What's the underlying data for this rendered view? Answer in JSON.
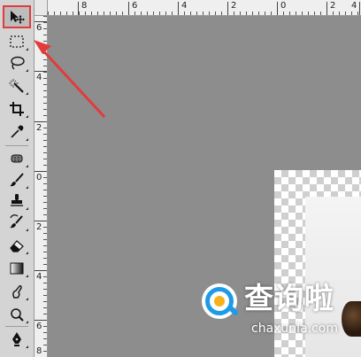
{
  "rulers": {
    "top_labels": [
      "8",
      "6",
      "4",
      "2",
      "0",
      "2",
      "4"
    ],
    "left_labels": [
      "6",
      "4",
      "2",
      "0",
      "2",
      "4",
      "6",
      "8"
    ]
  },
  "tools": [
    {
      "name": "move-tool",
      "selected": true
    },
    {
      "name": "rectangular-marquee-tool"
    },
    {
      "name": "lasso-tool"
    },
    {
      "name": "magic-wand-tool"
    },
    {
      "name": "crop-tool"
    },
    {
      "name": "eyedropper-tool"
    },
    {
      "name": "spot-healing-brush-tool"
    },
    {
      "name": "brush-tool"
    },
    {
      "name": "clone-stamp-tool"
    },
    {
      "name": "history-brush-tool"
    },
    {
      "name": "eraser-tool"
    },
    {
      "name": "gradient-tool"
    },
    {
      "name": "blur-tool"
    },
    {
      "name": "dodge-tool"
    },
    {
      "name": "pen-tool"
    }
  ],
  "watermark": {
    "title": "查询啦",
    "url": "chaxunla.com"
  },
  "colors": {
    "highlight": "#e23b3b",
    "brand_blue": "#1e9be6",
    "brand_yellow": "#f5b21b"
  }
}
